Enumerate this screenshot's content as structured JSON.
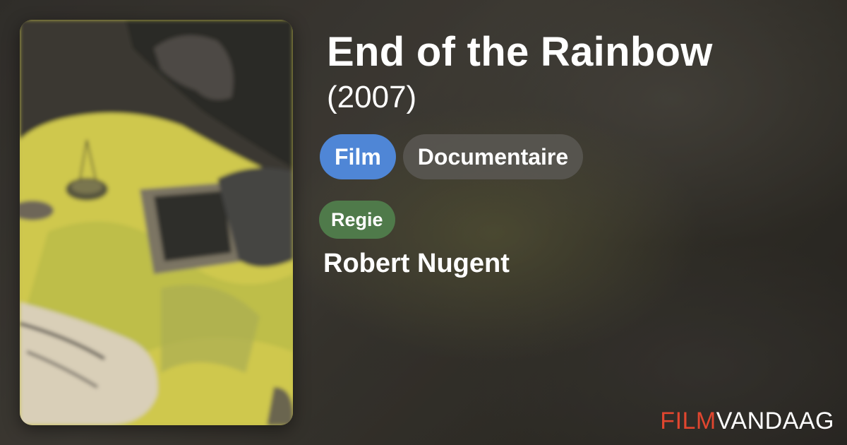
{
  "movie": {
    "title": "End of the Rainbow",
    "year": "(2007)"
  },
  "tags": [
    {
      "label": "Film",
      "color": "#4f86d6"
    },
    {
      "label": "Documentaire",
      "color": "#5a5854"
    }
  ],
  "credits": {
    "role": "Regie",
    "role_color": "#4f7a4a",
    "name": "Robert Nugent"
  },
  "poster": {
    "icon": "movie-poster-image"
  },
  "brand": {
    "part1": "FILM",
    "part2": "VANDAAG",
    "accent_color": "#e0462f"
  }
}
